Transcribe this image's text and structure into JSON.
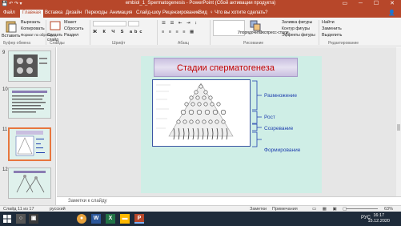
{
  "window": {
    "title": "embiol_1_Spermatogenesis - PowerPoint (Сбой активации продукта)"
  },
  "tabs": [
    "Файл",
    "Главная",
    "Вставка",
    "Дизайн",
    "Переходы",
    "Анимация",
    "Слайд-шоу",
    "Рецензирование",
    "Вид"
  ],
  "active_tab": "Главная",
  "tell_me": "♀ Что вы хотите сделать?",
  "ribbon": {
    "paste": "Вставить",
    "cut": "Вырезать",
    "copy": "Копировать",
    "format_painter": "Формат по образцу",
    "new_slide": "Создать слайд",
    "layout": "Макет",
    "reset": "Сбросить",
    "section": "Раздел",
    "arrange": "Упорядочить",
    "quick_styles": "Экспресс-стили",
    "shape_fill": "Заливка фигуры",
    "shape_outline": "Контур фигуры",
    "shape_effects": "Эффекты фигуры",
    "find": "Найти",
    "replace": "Заменить",
    "select": "Выделить",
    "groups": {
      "clipboard": "Буфер обмена",
      "slides": "Слайды",
      "font": "Шрифт",
      "paragraph": "Абзац",
      "drawing": "Рисование",
      "editing": "Редактирование"
    }
  },
  "thumbnails": [
    {
      "num": "9",
      "selected": false
    },
    {
      "num": "10",
      "selected": false
    },
    {
      "num": "11",
      "selected": true
    },
    {
      "num": "12",
      "selected": false
    }
  ],
  "slide": {
    "title": "Стадии сперматогенеза",
    "stages": [
      "Размножение",
      "Рост",
      "Созревание",
      "Формирование"
    ]
  },
  "notes": {
    "placeholder": "Заметки к слайду"
  },
  "status": {
    "slide_of": "Слайд 11 из 17",
    "language": "русский",
    "notes_btn": "Заметки",
    "comments_btn": "Примечания",
    "zoom": "63%"
  },
  "taskbar": {
    "language": "РУС",
    "time": "16:17",
    "date": "15.12.2020"
  },
  "colors": {
    "accent": "#b7472a",
    "slide_bg": "#cfeee6",
    "stage_text": "#1f3fae",
    "title_text": "#c00000"
  }
}
